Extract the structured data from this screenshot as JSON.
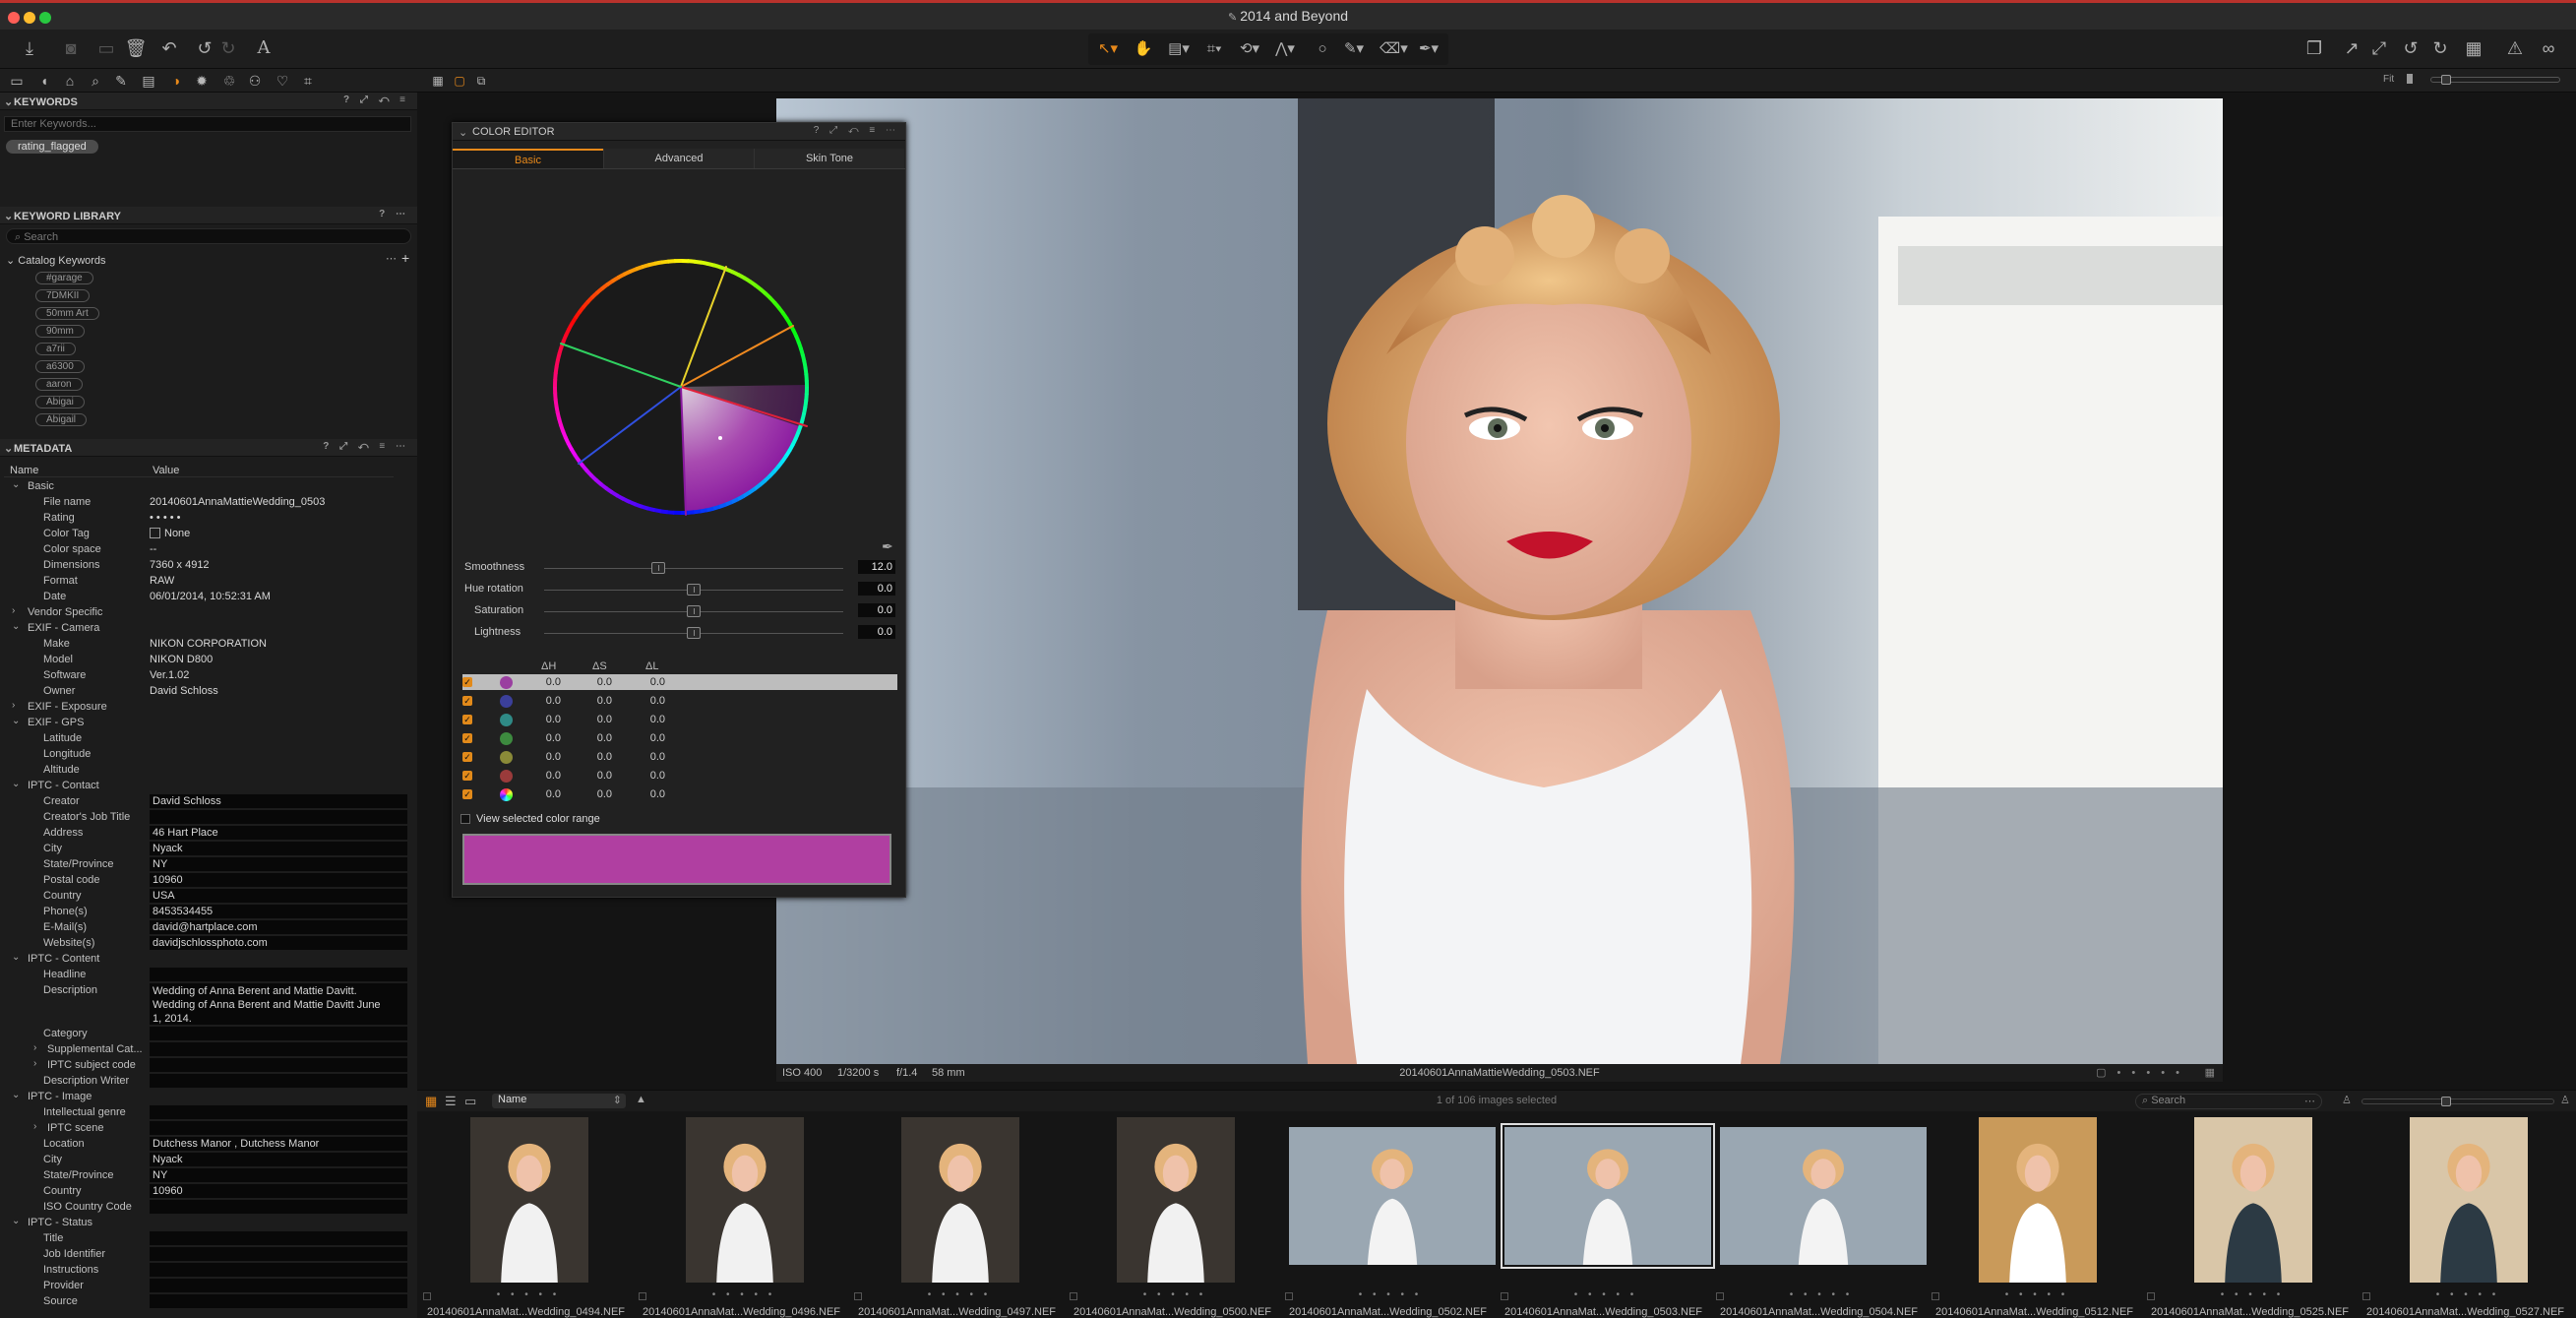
{
  "window": {
    "title": "2014 and Beyond"
  },
  "colors": {
    "accent": "#e8891a",
    "close": "#ff5f57",
    "minimize": "#febc2e",
    "zoom": "#28c840",
    "title_bar_top": "#b8322c",
    "range_fill": "#b03fa1"
  },
  "toolbar": {
    "left_icons": [
      "import-icon",
      "camera-icon",
      "export-icon",
      "trash-icon",
      "reset-icon",
      "undo-icon",
      "redo-icon",
      "text-icon"
    ],
    "tool_icons": [
      "cursor-tool-icon",
      "pan-tool-icon",
      "loupe-tool-icon",
      "crop-tool-icon",
      "rotate-tool-icon",
      "keystone-tool-icon",
      "mask-circle-icon",
      "brush-icon",
      "eraser-icon",
      "picker-icon"
    ],
    "right_icons": [
      "stack-icon",
      "expand-icon",
      "compare-icon",
      "rotate-left-icon",
      "rotate-right-icon",
      "grid-icon",
      "warning-icon",
      "glasses-icon"
    ]
  },
  "left_panel": {
    "keywords": {
      "header": "KEYWORDS",
      "placeholder": "Enter Keywords...",
      "chips": [
        "rating_flagged"
      ]
    },
    "keyword_library": {
      "header": "KEYWORD LIBRARY",
      "search_placeholder": "Search",
      "catalog_label": "Catalog Keywords",
      "items": [
        "#garage",
        "7DMKII",
        "50mm Art",
        "90mm",
        "a7rii",
        "a6300",
        "aaron",
        "Abigai",
        "Abigail"
      ]
    },
    "metadata": {
      "header": "METADATA",
      "col_name": "Name",
      "col_value": "Value",
      "rows": [
        {
          "name": "Basic",
          "level": 0,
          "group": "open"
        },
        {
          "name": "File name",
          "value": "20140601AnnaMattieWedding_0503",
          "level": 1
        },
        {
          "name": "Rating",
          "value": "• • • • •",
          "level": 1
        },
        {
          "name": "Color Tag",
          "value": "None",
          "level": 1,
          "swatch": true
        },
        {
          "name": "Color space",
          "value": "--",
          "level": 1
        },
        {
          "name": "Dimensions",
          "value": "7360 x 4912",
          "level": 1
        },
        {
          "name": "Format",
          "value": "RAW",
          "level": 1
        },
        {
          "name": "Date",
          "value": "06/01/2014, 10:52:31 AM",
          "level": 1
        },
        {
          "name": "Vendor Specific",
          "level": 0,
          "group": "closed"
        },
        {
          "name": "EXIF - Camera",
          "level": 0,
          "group": "open"
        },
        {
          "name": "Make",
          "value": "NIKON CORPORATION",
          "level": 1
        },
        {
          "name": "Model",
          "value": "NIKON D800",
          "level": 1
        },
        {
          "name": "Software",
          "value": "Ver.1.02",
          "level": 1
        },
        {
          "name": "Owner",
          "value": "David Schloss",
          "level": 1
        },
        {
          "name": "EXIF - Exposure",
          "level": 0,
          "group": "closed"
        },
        {
          "name": "EXIF - GPS",
          "level": 0,
          "group": "open"
        },
        {
          "name": "Latitude",
          "value": "",
          "level": 1
        },
        {
          "name": "Longitude",
          "value": "",
          "level": 1
        },
        {
          "name": "Altitude",
          "value": "",
          "level": 1
        },
        {
          "name": "IPTC - Contact",
          "level": 0,
          "group": "open"
        },
        {
          "name": "Creator",
          "value": "David Schloss",
          "level": 1,
          "editable": true
        },
        {
          "name": "Creator's Job Title",
          "value": "",
          "level": 1,
          "editable": true
        },
        {
          "name": "Address",
          "value": "46 Hart Place",
          "level": 1,
          "editable": true
        },
        {
          "name": "City",
          "value": "Nyack",
          "level": 1,
          "editable": true
        },
        {
          "name": "State/Province",
          "value": "NY",
          "level": 1,
          "editable": true
        },
        {
          "name": "Postal code",
          "value": "10960",
          "level": 1,
          "editable": true
        },
        {
          "name": "Country",
          "value": "USA",
          "level": 1,
          "editable": true
        },
        {
          "name": "Phone(s)",
          "value": "8453534455",
          "level": 1,
          "editable": true
        },
        {
          "name": "E-Mail(s)",
          "value": "david@hartplace.com",
          "level": 1,
          "editable": true
        },
        {
          "name": "Website(s)",
          "value": "davidjschlossphoto.com",
          "level": 1,
          "editable": true
        },
        {
          "name": "IPTC - Content",
          "level": 0,
          "group": "open"
        },
        {
          "name": "Headline",
          "value": "",
          "level": 1,
          "editable": true
        },
        {
          "name": "Description",
          "value": "Wedding of Anna Berent and Mattie Davitt.|Wedding of Anna Berent and Mattie Davitt June|1, 2014.",
          "level": 1,
          "editable": true,
          "lines": 3
        },
        {
          "name": "Category",
          "value": "",
          "level": 1,
          "editable": true
        },
        {
          "name": "Supplemental Cat...",
          "value": "",
          "level": 1,
          "editable": true,
          "group": "closed"
        },
        {
          "name": "IPTC subject code",
          "value": "",
          "level": 1,
          "editable": true,
          "group": "closed"
        },
        {
          "name": "Description Writer",
          "value": "",
          "level": 1,
          "editable": true
        },
        {
          "name": "IPTC - Image",
          "level": 0,
          "group": "open"
        },
        {
          "name": "Intellectual genre",
          "value": "",
          "level": 1,
          "editable": true
        },
        {
          "name": "IPTC scene",
          "value": "",
          "level": 1,
          "editable": true,
          "group": "closed"
        },
        {
          "name": "Location",
          "value": "Dutchess Manor , Dutchess Manor",
          "level": 1,
          "editable": true
        },
        {
          "name": "City",
          "value": "Nyack",
          "level": 1,
          "editable": true
        },
        {
          "name": "State/Province",
          "value": "NY",
          "level": 1,
          "editable": true
        },
        {
          "name": "Country",
          "value": "10960",
          "level": 1,
          "editable": true
        },
        {
          "name": "ISO Country Code",
          "value": "",
          "level": 1,
          "editable": true
        },
        {
          "name": "IPTC - Status",
          "level": 0,
          "group": "open"
        },
        {
          "name": "Title",
          "value": "",
          "level": 1,
          "editable": true
        },
        {
          "name": "Job Identifier",
          "value": "",
          "level": 1,
          "editable": true
        },
        {
          "name": "Instructions",
          "value": "",
          "level": 1,
          "editable": true
        },
        {
          "name": "Provider",
          "value": "",
          "level": 1,
          "editable": true
        },
        {
          "name": "Source",
          "value": "",
          "level": 1,
          "editable": true
        }
      ]
    }
  },
  "color_editor": {
    "title": "COLOR EDITOR",
    "tabs": [
      "Basic",
      "Advanced",
      "Skin Tone"
    ],
    "active_tab": "Basic",
    "sliders": [
      {
        "label": "Smoothness",
        "value": "12.0",
        "position": 0.38
      },
      {
        "label": "Hue rotation",
        "value": "0.0",
        "position": 0.5
      },
      {
        "label": "Saturation",
        "value": "0.0",
        "position": 0.5
      },
      {
        "label": "Lightness",
        "value": "0.0",
        "position": 0.5
      }
    ],
    "table_headers": [
      "ΔH",
      "ΔS",
      "ΔL"
    ],
    "ranges": [
      {
        "color": "#9a3fa0",
        "dh": "0.0",
        "ds": "0.0",
        "dl": "0.0",
        "selected": true
      },
      {
        "color": "#3b3f9a",
        "dh": "0.0",
        "ds": "0.0",
        "dl": "0.0"
      },
      {
        "color": "#2f8a86",
        "dh": "0.0",
        "ds": "0.0",
        "dl": "0.0"
      },
      {
        "color": "#3d8a3f",
        "dh": "0.0",
        "ds": "0.0",
        "dl": "0.0"
      },
      {
        "color": "#8a8a38",
        "dh": "0.0",
        "ds": "0.0",
        "dl": "0.0"
      },
      {
        "color": "#9a3b3b",
        "dh": "0.0",
        "ds": "0.0",
        "dl": "0.0"
      },
      {
        "color": "rainbow",
        "dh": "0.0",
        "ds": "0.0",
        "dl": "0.0"
      }
    ],
    "view_selected_label": "View selected color range"
  },
  "viewer": {
    "iso": "ISO 400",
    "shutter": "1/3200 s",
    "aperture": "f/1.4",
    "focal": "58 mm",
    "filename": "20140601AnnaMattieWedding_0503.NEF",
    "fit_label": "Fit"
  },
  "browser": {
    "sort_label": "Name",
    "count_label": "1 of 106 images selected",
    "search_placeholder": "Search",
    "thumbnails": [
      {
        "name": "20140601AnnaMat...Wedding_0494.NEF",
        "orientation": "portrait"
      },
      {
        "name": "20140601AnnaMat...Wedding_0496.NEF",
        "orientation": "portrait"
      },
      {
        "name": "20140601AnnaMat...Wedding_0497.NEF",
        "orientation": "portrait"
      },
      {
        "name": "20140601AnnaMat...Wedding_0500.NEF",
        "orientation": "portrait"
      },
      {
        "name": "20140601AnnaMat...Wedding_0502.NEF",
        "orientation": "landscape"
      },
      {
        "name": "20140601AnnaMat...Wedding_0503.NEF",
        "orientation": "landscape",
        "selected": true
      },
      {
        "name": "20140601AnnaMat...Wedding_0504.NEF",
        "orientation": "landscape"
      },
      {
        "name": "20140601AnnaMat...Wedding_0512.NEF",
        "orientation": "portrait-warm"
      },
      {
        "name": "20140601AnnaMat...Wedding_0525.NEF",
        "orientation": "portrait-stairs"
      },
      {
        "name": "20140601AnnaMat...Wedding_0527.NEF",
        "orientation": "portrait-stairs"
      }
    ]
  }
}
